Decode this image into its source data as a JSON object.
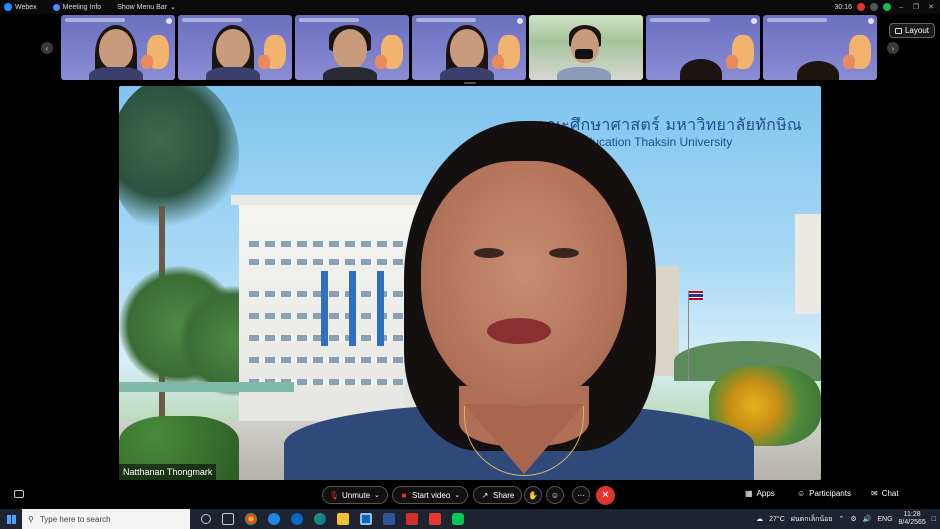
{
  "topbar": {
    "app_name": "Webex",
    "meeting_info": "Meeting Info",
    "show_menu_bar": "Show Menu Bar",
    "timer": "30:16"
  },
  "filmstrip": {
    "tiles": [
      {
        "kind": "virtual-bg"
      },
      {
        "kind": "virtual-bg"
      },
      {
        "kind": "virtual-bg"
      },
      {
        "kind": "virtual-bg"
      },
      {
        "kind": "camera"
      },
      {
        "kind": "virtual-bg"
      },
      {
        "kind": "virtual-bg"
      }
    ],
    "layout_label": "Layout"
  },
  "main_video": {
    "banner_thai": "คณะศึกษาศาสตร์ มหาวิทยาลัยทักษิณ",
    "banner_english": "lty of Education Thaksin University",
    "speaker_name": "Natthanan Thongmark"
  },
  "controls": {
    "unmute": "Unmute",
    "start_video": "Start video",
    "share": "Share",
    "more": "···",
    "apps": "Apps",
    "participants": "Participants",
    "chat": "Chat",
    "end_color": "#e0342c"
  },
  "taskbar": {
    "search_placeholder": "Type here to search",
    "weather": "27°C",
    "weather_text": "ฝนตกเล็กน้อย",
    "language": "ENG",
    "time": "11:28",
    "date": "8/4/2565"
  },
  "colors": {
    "accent_blue": "#1d4f8a",
    "recording_red": "#e0342c"
  }
}
